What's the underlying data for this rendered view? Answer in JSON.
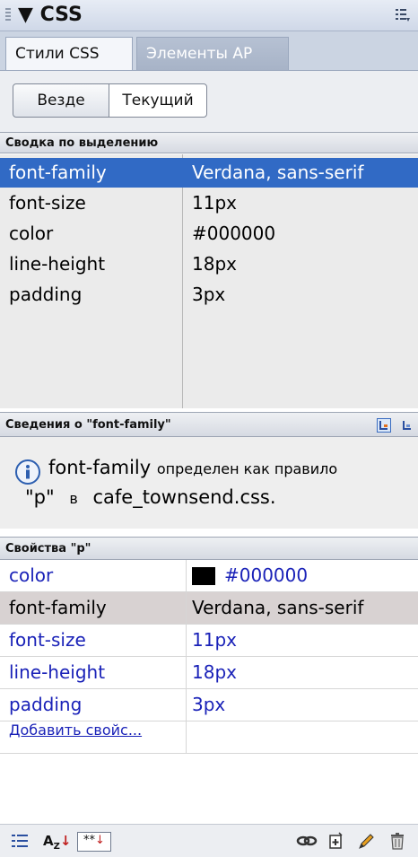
{
  "panel": {
    "title": "CSS"
  },
  "tabs": [
    {
      "label": "Стили CSS"
    },
    {
      "label": "Элементы AP"
    }
  ],
  "toggle": {
    "all_label": "Везде",
    "current_label": "Текущий"
  },
  "summary": {
    "heading": "Сводка по выделению",
    "rows": [
      {
        "prop": "font-family",
        "value": "Verdana, sans-serif"
      },
      {
        "prop": "font-size",
        "value": "11px"
      },
      {
        "prop": "color",
        "value": "#000000"
      },
      {
        "prop": "line-height",
        "value": "18px"
      },
      {
        "prop": "padding",
        "value": "3px"
      }
    ]
  },
  "info": {
    "heading": "Сведения о \"font-family\"",
    "prop": "font-family",
    "defined_as": "определен как правило",
    "rule": "\"p\"",
    "in": "в",
    "file": "cafe_townsend.css."
  },
  "properties": {
    "heading": "Свойства \"p\"",
    "rows": [
      {
        "prop": "color",
        "value": "#000000",
        "swatch": "#000000"
      },
      {
        "prop": "font-family",
        "value": "Verdana, sans-serif"
      },
      {
        "prop": "font-size",
        "value": "11px"
      },
      {
        "prop": "line-height",
        "value": "18px"
      },
      {
        "prop": "padding",
        "value": "3px"
      }
    ],
    "add_label": "Добавить свойс..."
  },
  "colors": {
    "selection": "#316ac5",
    "link": "#1a22b8",
    "highlight_row": "#d8d2d2"
  }
}
